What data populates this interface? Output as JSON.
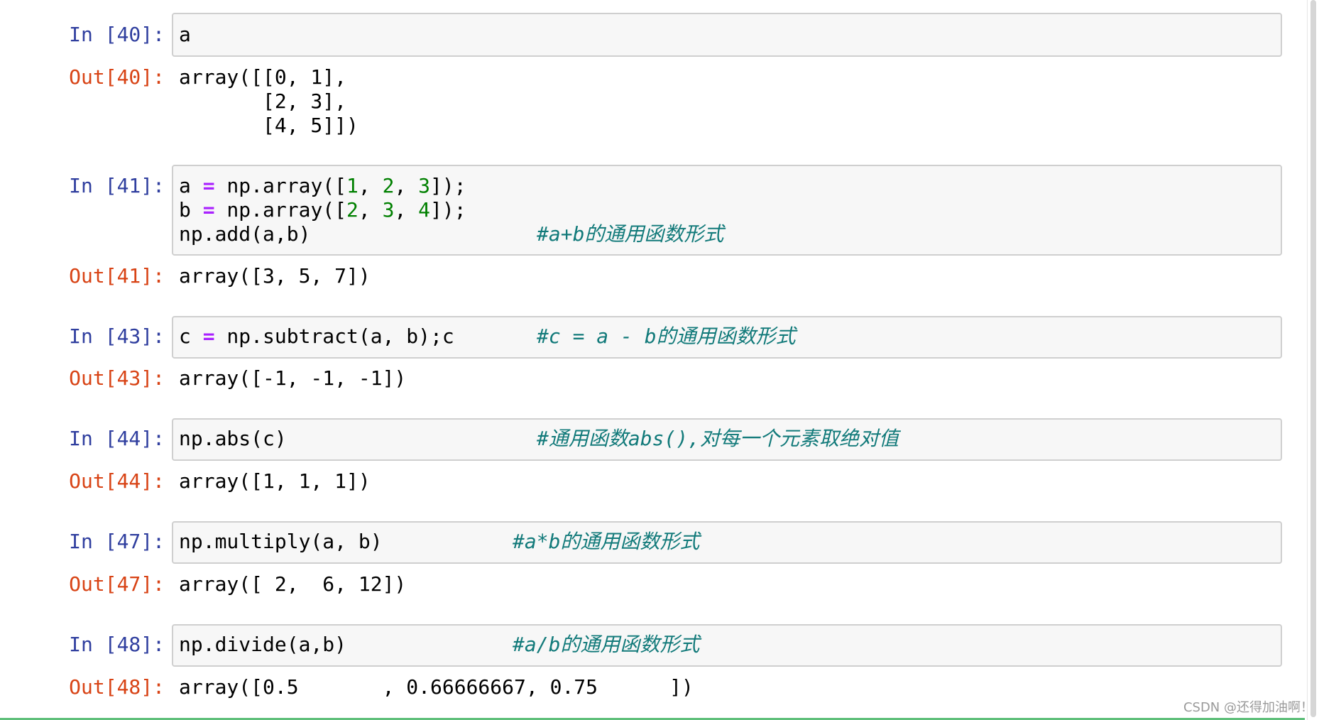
{
  "cells": [
    {
      "in_prompt": "In [40]:",
      "code_line1": "a",
      "out_prompt": "Out[40]:",
      "output_lines": [
        "array([[0, 1],",
        "       [2, 3],",
        "       [4, 5]])"
      ]
    },
    {
      "in_prompt": "In [41]:",
      "line1": {
        "a": "a ",
        "op": "=",
        "b": " np.array([",
        "n1": "1",
        "c1": ", ",
        "n2": "2",
        "c2": ", ",
        "n3": "3",
        "e": "]);"
      },
      "line2": {
        "a": "b ",
        "op": "=",
        "b": " np.array([",
        "n1": "2",
        "c1": ", ",
        "n2": "3",
        "c2": ", ",
        "n3": "4",
        "e": "]);"
      },
      "line3_code": "np.add(a,b)",
      "line3_comment": "#a+b的通用函数形式",
      "out_prompt": "Out[41]:",
      "output": "array([3, 5, 7])"
    },
    {
      "in_prompt": "In [43]:",
      "code_a": "c ",
      "code_op": "=",
      "code_b": " np.subtract(a, b);c",
      "comment": "#c = a - b的通用函数形式",
      "out_prompt": "Out[43]:",
      "output": "array([-1, -1, -1])"
    },
    {
      "in_prompt": "In [44]:",
      "code": "np.abs(c)",
      "comment": "#通用函数abs(),对每一个元素取绝对值",
      "out_prompt": "Out[44]:",
      "output": "array([1, 1, 1])"
    },
    {
      "in_prompt": "In [47]:",
      "code": "np.multiply(a, b)",
      "comment": "#a*b的通用函数形式",
      "out_prompt": "Out[47]:",
      "output": "array([ 2,  6, 12])"
    },
    {
      "in_prompt": "In [48]:",
      "code": "np.divide(a,b)",
      "comment": "#a/b的通用函数形式",
      "out_prompt": "Out[48]:",
      "output": "array([0.5       , 0.66666667, 0.75      ])"
    }
  ],
  "watermark": "CSDN @还得加油啊！",
  "colors": {
    "in_prompt": "#303f9f",
    "out_prompt": "#d84315",
    "operator": "#aa22ff",
    "number": "#008000",
    "comment": "#127a7a",
    "cell_bg": "#f7f7f7",
    "cell_border": "#cfcfcf"
  }
}
